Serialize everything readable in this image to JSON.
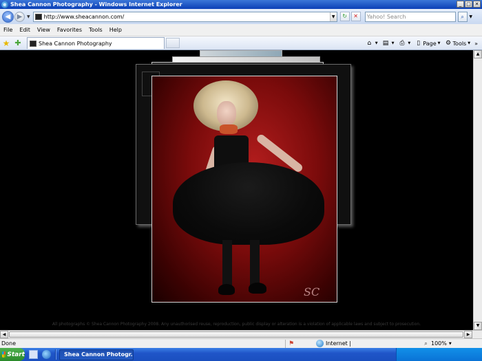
{
  "window": {
    "title": "Shea Cannon Photography - Windows Internet Explorer",
    "min": "_",
    "max": "□",
    "close": "✕"
  },
  "address_bar": {
    "url": "http://www.sheacannon.com/",
    "search_placeholder": "Yahoo! Search"
  },
  "menu": [
    "File",
    "Edit",
    "View",
    "Favorites",
    "Tools",
    "Help"
  ],
  "tab": {
    "label": "Shea Cannon Photography"
  },
  "command_bar": {
    "page_label": "Page",
    "tools_label": "Tools"
  },
  "page": {
    "copyright": "All photographs © Shea Cannon Photography 2008. Any unauthorised reuse, reproduction, public display or alteration is a violation of applicable laws and subject to prosecution.",
    "logo_text": "SC"
  },
  "status_bar": {
    "status": "Done",
    "zone": "Internet |",
    "zoom": "100%"
  },
  "taskbar": {
    "start_label": "Start",
    "window_button": "Shea Cannon Photogr..."
  },
  "icons": {
    "back": "back-arrow-icon",
    "forward": "forward-arrow-icon",
    "refresh": "refresh-icon",
    "stop": "stop-icon",
    "search": "search-icon",
    "favorites": "favorites-star-icon",
    "add_favorites": "add-favorites-icon",
    "home": "home-icon",
    "feeds": "feeds-icon",
    "print": "print-icon",
    "page": "page-icon",
    "tools": "tools-gear-icon",
    "globe": "internet-zone-icon",
    "zoom": "zoom-icon"
  }
}
